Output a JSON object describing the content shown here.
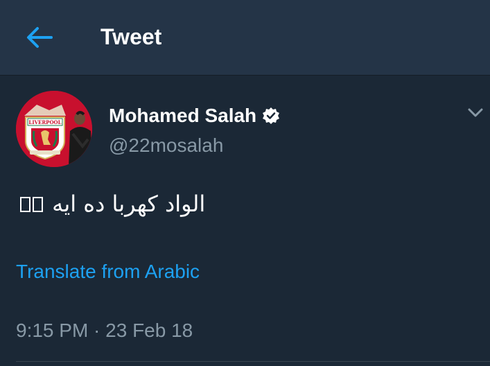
{
  "header": {
    "title": "Tweet",
    "back_icon": "arrow-left-icon",
    "accent_color": "#1da1f2"
  },
  "tweet": {
    "author_name": "Mohamed Salah",
    "verified": true,
    "handle": "@22mosalah",
    "text_arabic": "الواد كهربا ده ايه",
    "emoji_count": 2,
    "translate_label": "Translate from Arabic",
    "timestamp": "9:15 PM · 23 Feb 18",
    "avatar_icon": "liverpool-crest-avatar",
    "more_icon": "chevron-down-icon"
  },
  "colors": {
    "background": "#1b2836",
    "header_bg": "#243447",
    "secondary_text": "#8899a6",
    "link": "#1da1f2",
    "avatar_red": "#c8102e"
  }
}
